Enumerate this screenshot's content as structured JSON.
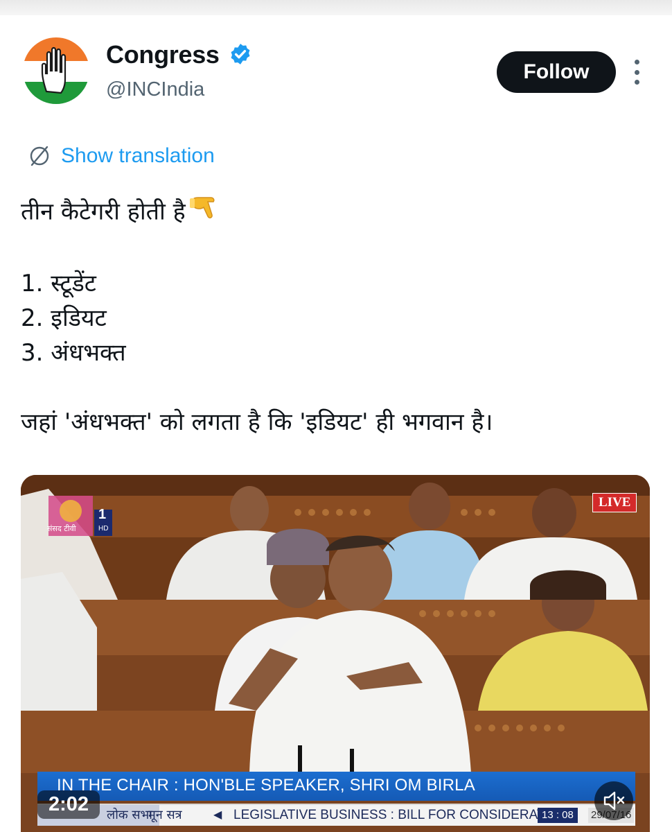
{
  "account": {
    "name": "Congress",
    "handle": "@INCIndia",
    "verified": true,
    "verified_color": "#1d9bf0"
  },
  "actions": {
    "follow_label": "Follow",
    "more_icon": "more-vertical-icon"
  },
  "translation": {
    "label": "Show translation",
    "icon": "globe-icon"
  },
  "tweet": {
    "line1": "तीन कैटेगरी होती है",
    "emoji": "backhand-index-pointing-down",
    "item1": "1. स्टूडेंट",
    "item2": "2. इडियट",
    "item3": "3. अंधभक्त",
    "line_last": "जहां 'अंधभक्त' को लगता है कि 'इडियट' ही भगवान है।"
  },
  "video": {
    "live_label": "LIVE",
    "channel_name": "संसद टीवी",
    "channel_number": "1",
    "channel_hd": "HD",
    "chair_text": "IN THE CHAIR : HON'BLE SPEAKER, SHRI OM BIRLA",
    "ticker_tag": "लोक सभा",
    "ticker_sub": "मून सत्र",
    "ticker_text": "LEGISLATIVE BUSINESS : BILL FOR CONSIDERATION",
    "ticker_time": "13 : 08",
    "ticker_date": "29/07/16",
    "duration": "2:02",
    "mute_icon": "volume-muted-icon"
  }
}
